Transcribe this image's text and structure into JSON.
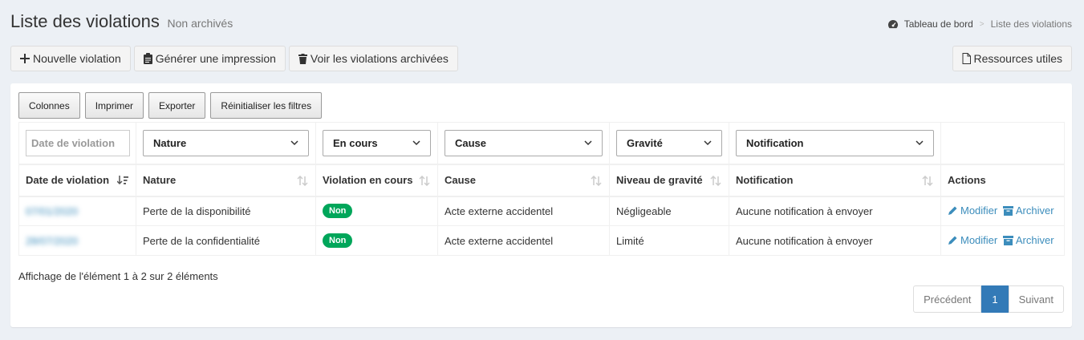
{
  "header": {
    "title": "Liste des violations",
    "subtitle": "Non archivés",
    "breadcrumb": [
      "Tableau de bord",
      "Liste des violations"
    ]
  },
  "toolbar": {
    "new_label": "Nouvelle violation",
    "print_label": "Générer une impression",
    "archived_label": "Voir les violations archivées",
    "resources_label": "Ressources utiles"
  },
  "table_buttons": [
    "Colonnes",
    "Imprimer",
    "Exporter",
    "Réinitialiser les filtres"
  ],
  "filters": {
    "date_placeholder": "Date de violation",
    "nature": "Nature",
    "en_cours": "En cours",
    "cause": "Cause",
    "gravite": "Gravité",
    "notification": "Notification"
  },
  "columns": [
    "Date de violation",
    "Nature",
    "Violation en cours",
    "Cause",
    "Niveau de gravité",
    "Notification",
    "Actions"
  ],
  "rows": [
    {
      "date": "07/01/2020",
      "nature": "Perte de la disponibilité",
      "en_cours": "Non",
      "cause": "Acte externe accidentel",
      "gravite": "Négligeable",
      "notification": "Aucune notification à envoyer"
    },
    {
      "date": "28/07/2020",
      "nature": "Perte de la confidentialité",
      "en_cours": "Non",
      "cause": "Acte externe accidentel",
      "gravite": "Limité",
      "notification": "Aucune notification à envoyer"
    }
  ],
  "actions": {
    "edit": "Modifier",
    "archive": "Archiver"
  },
  "info": "Affichage de l'élément 1 à 2 sur 2 éléments",
  "pagination": {
    "prev": "Précédent",
    "current": "1",
    "next": "Suivant"
  },
  "colors": {
    "accent": "#3c8dbc",
    "badge_green": "#00a65a",
    "page_active": "#337ab7"
  }
}
